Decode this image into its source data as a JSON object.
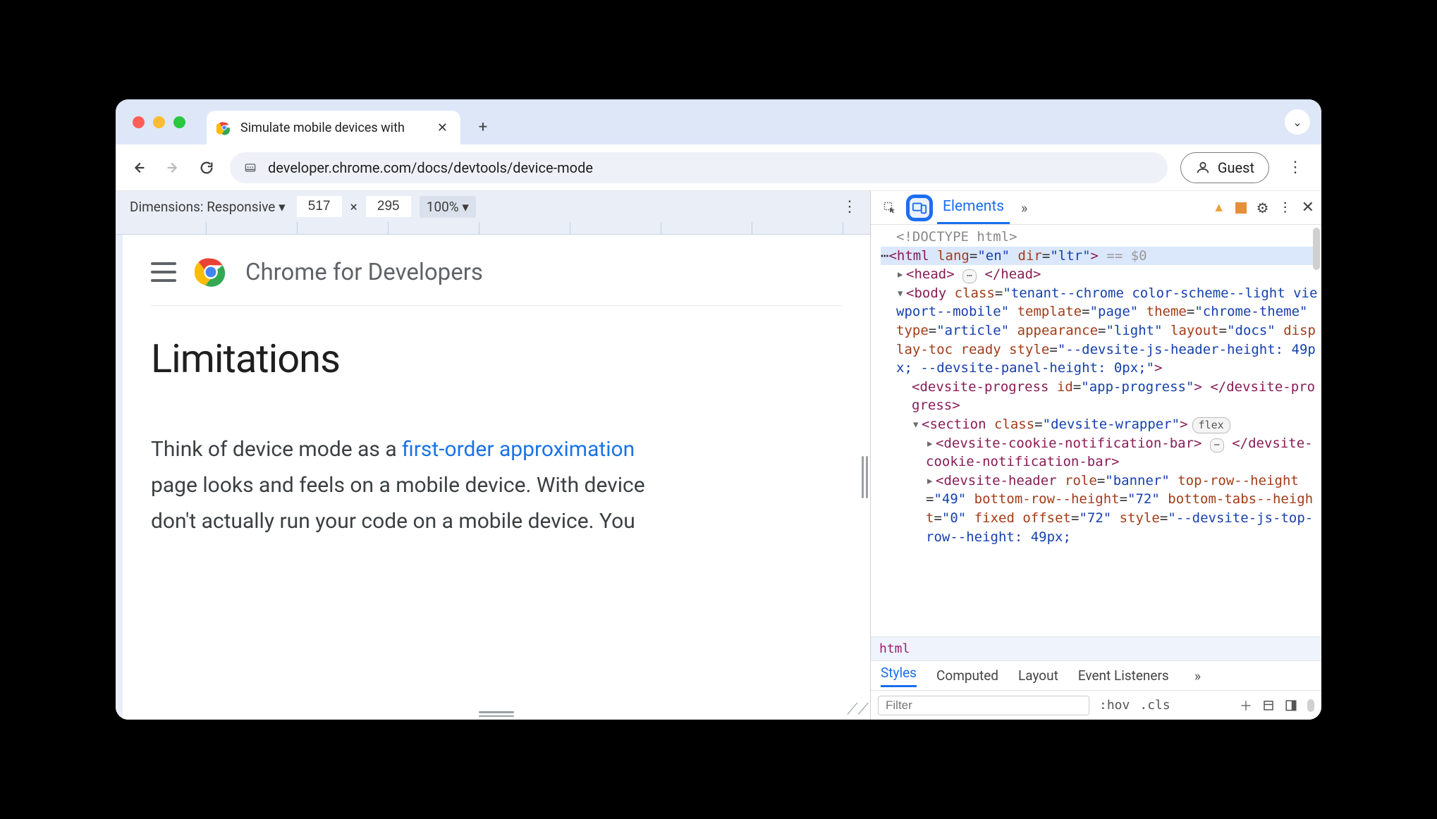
{
  "browser": {
    "tab_title": "Simulate mobile devices with",
    "new_tab": "+",
    "url": "developer.chrome.com/docs/devtools/device-mode",
    "guest_label": "Guest"
  },
  "device_toolbar": {
    "label": "Dimensions: Responsive",
    "width": "517",
    "sep": "×",
    "height": "295",
    "zoom": "100%"
  },
  "page": {
    "brand": "Chrome for Developers",
    "h1": "Limitations",
    "body_pre": "Think of device mode as a ",
    "body_link": "first-order approximation",
    "body_post1": " page looks and feels on a mobile device. With device",
    "body_post2": " don't actually run your code on a mobile device. You"
  },
  "devtools": {
    "tab": "Elements",
    "breadcrumb": "html",
    "styles_tabs": {
      "styles": "Styles",
      "computed": "Computed",
      "layout": "Layout",
      "events": "Event Listeners"
    },
    "filter_placeholder": "Filter",
    "hov": ":hov",
    "cls": ".cls",
    "flex_pill": "flex",
    "dom": {
      "doctype": "<!DOCTYPE html>",
      "html_open": "<html lang=\"en\" dir=\"ltr\">",
      "eq": " == $0",
      "head": "<head> ⋯ </head>",
      "body_open": "<body class=\"tenant--chrome color-scheme--light viewport--mobile\" template=\"page\" theme=\"chrome-theme\" type=\"article\" appearance=\"light\" layout=\"docs\" display-toc ready style=\"--devsite-js-header-height: 49px; --devsite-panel-height: 0px;\">",
      "progress": "<devsite-progress id=\"app-progress\"> </devsite-progress>",
      "section": "<section class=\"devsite-wrapper\">",
      "cookie": "<devsite-cookie-notification-bar> ⋯ </devsite-cookie-notification-bar>",
      "header": "<devsite-header role=\"banner\" top-row--height=\"49\" bottom-row--height=\"72\" bottom-tabs--height=\"0\" fixed offset=\"72\" style=\"--devsite-js-top-row--height: 49px;"
    }
  }
}
